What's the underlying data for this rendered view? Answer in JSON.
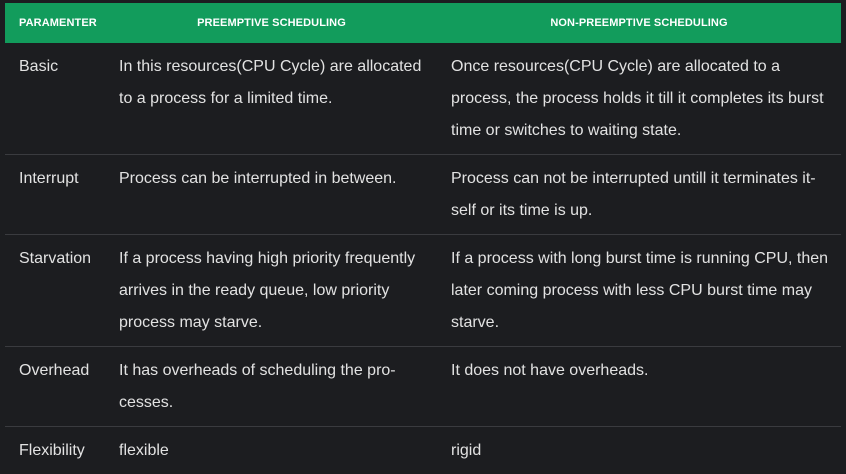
{
  "headers": {
    "parameter": "PARAMENTER",
    "preemptive": "PREEMPTIVE SCHEDULING",
    "non_preemptive": "NON-PREEMPTIVE SCHEDULING"
  },
  "rows": [
    {
      "parameter": "Basic",
      "preemptive": "In this resources(CPU Cycle) are allocated to a process for a limited time.",
      "non_preemptive": "Once resources(CPU Cycle) are allocated to a process, the process holds it till it completes its burst time or switches to waiting state."
    },
    {
      "parameter": "Interrupt",
      "preemptive": "Process can be interrupted in between.",
      "non_preemptive": "Process can not be interrupted untill it terminates it-self or its time is up."
    },
    {
      "parameter": "Starvation",
      "preemptive": "If a process having high priority frequently arrives in the ready queue, low priority process may starve.",
      "non_preemptive": "If a process with long burst time is running CPU, then later coming process with less CPU burst time may starve."
    },
    {
      "parameter": "Overhead",
      "preemptive": "It has overheads of scheduling the pro-cesses.",
      "non_preemptive": "It does not have overheads."
    },
    {
      "parameter": "Flexibility",
      "preemptive": "flexible",
      "non_preemptive": "rigid"
    }
  ],
  "colors": {
    "header_bg": "#129c5c",
    "page_bg": "#1c1d20",
    "divider": "#3a3b3f",
    "text": "#e2e2e2"
  }
}
